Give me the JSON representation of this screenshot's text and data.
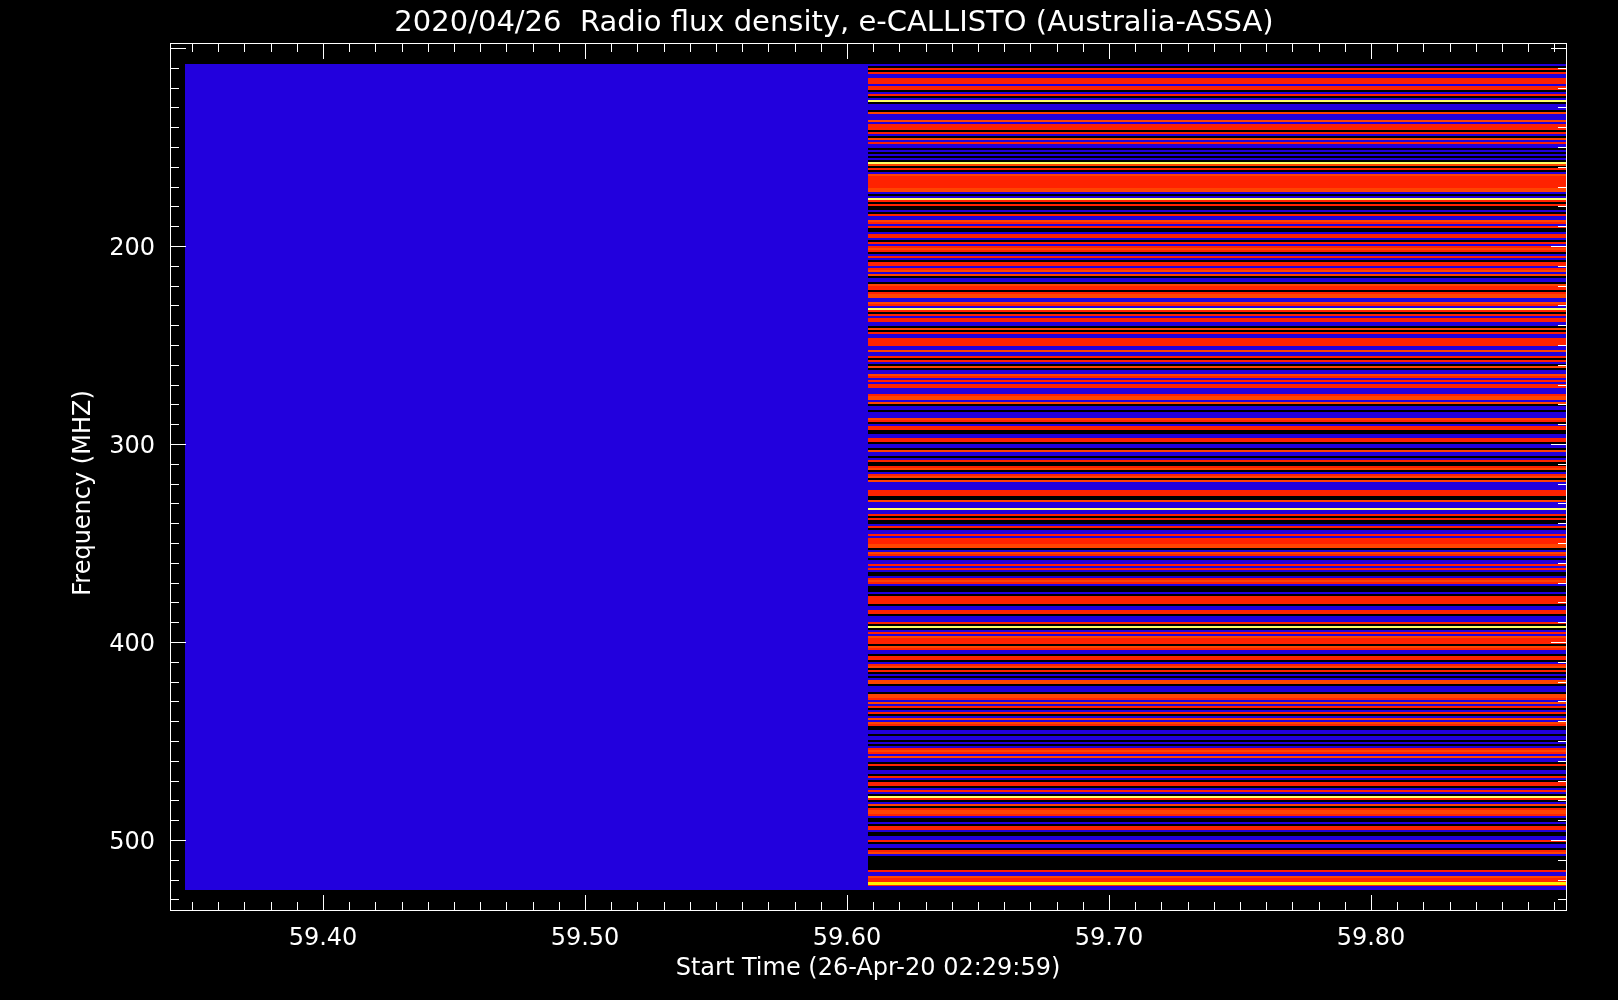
{
  "title": "2020/04/26  Radio flux density, e-CALLISTO (Australia-ASSA)",
  "plot": {
    "ylabel": "Frequency (MHZ)",
    "xlabel": "Start Time (26-Apr-20 02:29:59)",
    "yticks": [
      {
        "value": "200"
      },
      {
        "value": "300"
      },
      {
        "value": "400"
      },
      {
        "value": "500"
      }
    ],
    "xticks": [
      {
        "value": "59.40"
      },
      {
        "value": "59.50"
      },
      {
        "value": "59.60"
      },
      {
        "value": "59.70"
      },
      {
        "value": "59.80"
      }
    ]
  }
}
